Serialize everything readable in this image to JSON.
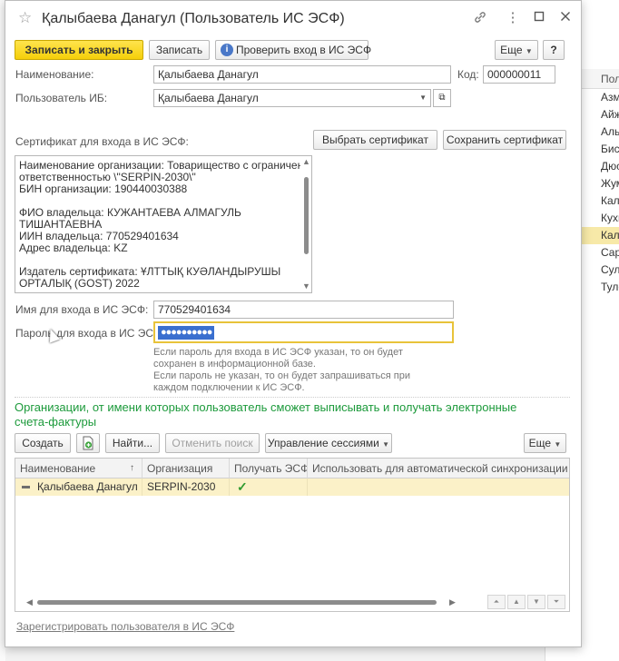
{
  "window": {
    "title": "Қалыбаева Данагул (Пользователь ИС ЭСФ)"
  },
  "toolbar": {
    "save_close": "Записать и закрыть",
    "save": "Записать",
    "check": "Проверить вход в ИС ЭСФ",
    "more": "Еще",
    "help": "?"
  },
  "form": {
    "name_label": "Наименование:",
    "name_value": "Қалыбаева Данагул",
    "code_label": "Код:",
    "code_value": "000000011",
    "user_label": "Пользователь ИБ:",
    "user_value": "Қалыбаева Данагул",
    "cert_label": "Сертификат для входа в ИС ЭСФ:",
    "choose_cert": "Выбрать сертификат",
    "save_cert": "Сохранить сертификат",
    "cert_lines": [
      "Наименование организации: Товарищество с ограниченной",
      "ответственностью \\\"SERPIN-2030\\\"",
      "БИН организации: 190440030388",
      "",
      "ФИО владельца: КУЖАНТАЕВА АЛМАГУЛЬ",
      "ТИШАНТАЕВНА",
      "ИИН владельца: 770529401634",
      "Адрес владельца: KZ",
      "",
      "Издатель сертификата: ҰЛТТЫҚ КУӘЛАНДЫРУШЫ",
      "ОРТАЛЫҚ (GOST) 2022"
    ],
    "login_label": "Имя для входа в ИС ЭСФ:",
    "login_value": "770529401634",
    "password_label": "Пароль для входа в ИС ЭСФ:",
    "password_value": "●●●●●●●●●●",
    "hint_lines": [
      "Если пароль для входа в ИС ЭСФ указан, то он будет",
      "сохранен в информационной базе.",
      "Если пароль не указан, то он будет запрашиваться при",
      "каждом подключении к ИС ЭСФ."
    ]
  },
  "orgs": {
    "title": "Организации, от имени которых пользователь сможет выписывать и получать электронные счета-фактуры",
    "create": "Создать",
    "find": "Найти...",
    "cancel_search": "Отменить поиск",
    "sessions": "Управление сессиями",
    "more": "Еще",
    "columns": [
      "Наименование",
      "Организация",
      "Получать ЭСФ",
      "Использовать для автоматической синхронизации с ИС"
    ],
    "rows": [
      {
        "name": "Қалыбаева Данагул",
        "org": "SERPIN-2030",
        "receive": "✓",
        "auto": ""
      }
    ]
  },
  "footer": {
    "register": "Зарегистрировать пользователя в ИС ЭСФ"
  },
  "background": {
    "header": "Пол",
    "rows": [
      "Азм",
      "Айж",
      "Аль",
      "Бис",
      "Дюс",
      "Жум",
      "Кал",
      "Кухм",
      "Кал",
      "Сара",
      "Султ",
      "Туле"
    ]
  }
}
